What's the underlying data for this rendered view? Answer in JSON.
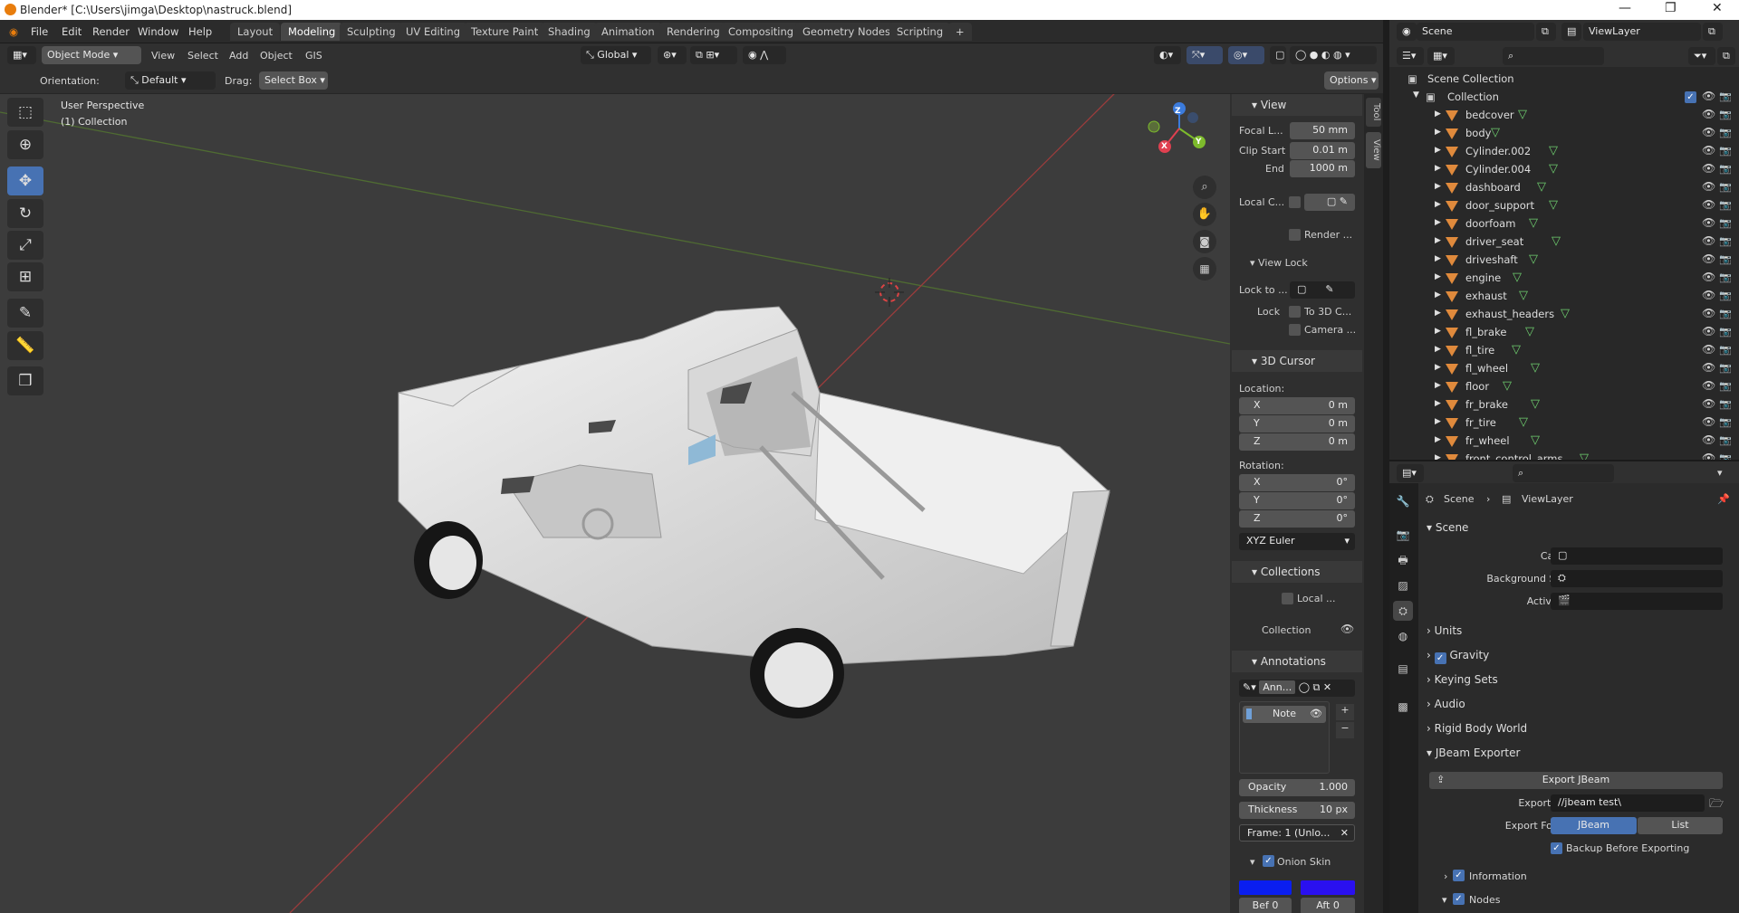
{
  "window": {
    "title": "Blender* [C:\\Users\\jimga\\Desktop\\nastruck.blend]",
    "controls": [
      "—",
      "❐",
      "✕"
    ]
  },
  "menu": [
    "File",
    "Edit",
    "Render",
    "Window",
    "Help"
  ],
  "workspaces": [
    "Layout",
    "Modeling",
    "Sculpting",
    "UV Editing",
    "Texture Paint",
    "Shading",
    "Animation",
    "Rendering",
    "Compositing",
    "Geometry Nodes",
    "Scripting",
    "+"
  ],
  "active_workspace": "Modeling",
  "scene_selector": {
    "scene": "Scene",
    "view_layer": "ViewLayer"
  },
  "header": {
    "mode": "Object Mode",
    "menus": [
      "View",
      "Select",
      "Add",
      "Object",
      "GIS"
    ],
    "transform_orientation": "Global"
  },
  "tool_settings": {
    "orientation_label": "Orientation:",
    "orientation_value": "Default",
    "drag_label": "Drag:",
    "drag_value": "Select Box",
    "options": "Options"
  },
  "viewport": {
    "perspective": "User Perspective",
    "collection": "(1) Collection",
    "gizmo": {
      "x": "X",
      "y": "Y",
      "z": "Z"
    }
  },
  "left_tools": [
    "select-box",
    "cursor",
    "move",
    "rotate",
    "scale",
    "transform",
    "annotate",
    "measure",
    "add-cube"
  ],
  "npanel": {
    "tabs": [
      "Tool",
      "View"
    ],
    "view": {
      "title": "View",
      "focal_label": "Focal L...",
      "focal_value": "50 mm",
      "clip_start_label": "Clip Start",
      "clip_start_value": "0.01 m",
      "end_label": "End",
      "end_value": "1000 m",
      "local_camera_label": "Local C...",
      "render_region_label": "Render ...",
      "view_lock_title": "View Lock",
      "lock_to_label": "Lock to ...",
      "lock_label": "Lock",
      "to_3d_cursor_label": "To 3D C...",
      "camera_label": "Camera ..."
    },
    "cursor": {
      "title": "3D Cursor",
      "location_label": "Location:",
      "loc_x": "0 m",
      "loc_y": "0 m",
      "loc_z": "0 m",
      "rotation_label": "Rotation:",
      "rot_x": "0°",
      "rot_y": "0°",
      "rot_z": "0°",
      "mode": "XYZ Euler",
      "x": "X",
      "y": "Y",
      "z": "Z"
    },
    "collections": {
      "title": "Collections",
      "local_label": "Local ...",
      "collection_label": "Collection"
    },
    "annotations": {
      "title": "Annotations",
      "name": "Ann...",
      "layer": "Note",
      "opacity_label": "Opacity",
      "opacity_value": "1.000",
      "thickness_label": "Thickness",
      "thickness_value": "10 px",
      "frame_label": "Frame: 1 (Unlo...",
      "onion_label": "Onion Skin",
      "bef_label": "Bef",
      "bef_value": "0",
      "aft_label": "Aft",
      "aft_value": "0",
      "bef_color": "#0a1ef0",
      "aft_color": "#2a10f0"
    }
  },
  "outliner": {
    "root": "Scene Collection",
    "collection": "Collection",
    "items": [
      "bedcover",
      "body",
      "Cylinder.002",
      "Cylinder.004",
      "dashboard",
      "door_support",
      "doorfoam",
      "driver_seat",
      "driveshaft",
      "engine",
      "exhaust",
      "exhaust_headers",
      "fl_brake",
      "fl_tire",
      "fl_wheel",
      "floor",
      "fr_brake",
      "fr_tire",
      "fr_wheel",
      "front_control_arms"
    ]
  },
  "properties": {
    "breadcrumb": [
      "Scene",
      "ViewLayer"
    ],
    "scene_section": "Scene",
    "camera_label": "Camera",
    "background_scene_label": "Background Scene",
    "active_clip_label": "Active Clip",
    "sections": [
      "Units",
      "Gravity",
      "Keying Sets",
      "Audio",
      "Rigid Body World",
      "JBeam Exporter"
    ],
    "export_button": "Export JBeam",
    "export_path_label": "Export Path",
    "export_path_value": "//jbeam test\\",
    "export_format_label": "Export Format",
    "format_options": [
      "JBeam",
      "List"
    ],
    "backup_label": "Backup Before Exporting",
    "information_label": "Information",
    "nodes_label": "Nodes"
  },
  "colors": {
    "accent": "#4772b3",
    "viewport_bg": "#3c3c3c",
    "mesh_icon": "#e08a3c",
    "vertex_icon": "#6fcf6f"
  }
}
